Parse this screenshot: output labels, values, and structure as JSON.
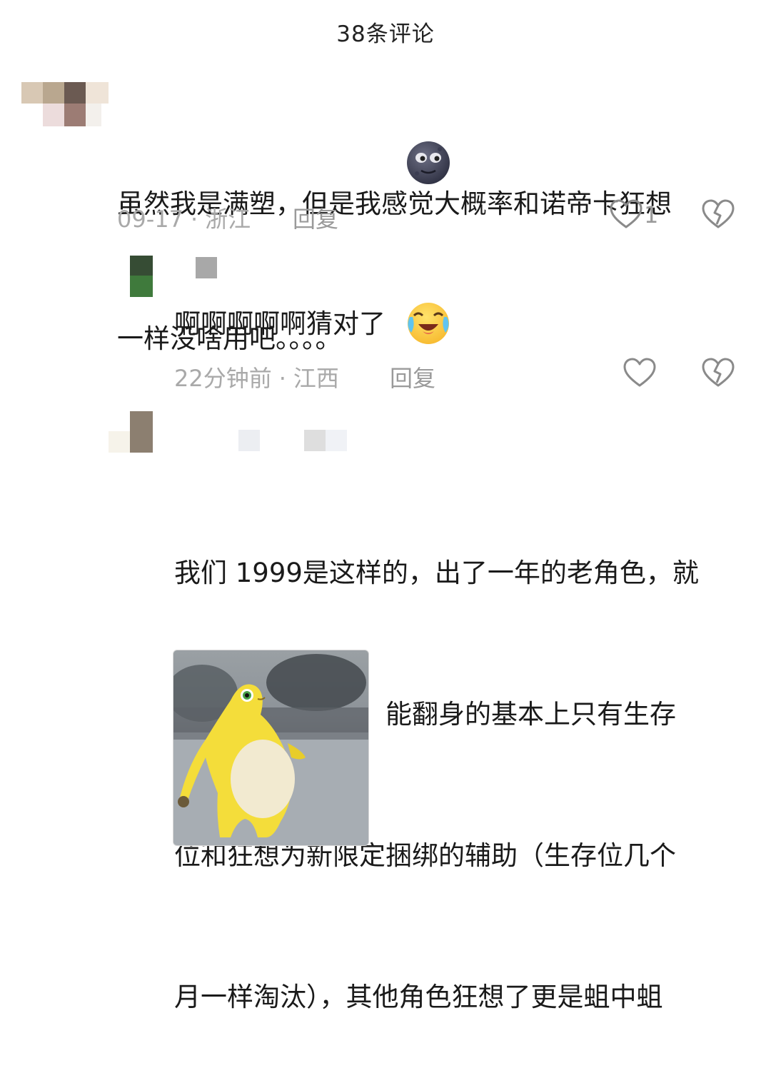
{
  "header": {
    "title": "38条评论"
  },
  "comments": [
    {
      "text_line1": "虽然我是满塑，但是我感觉大概率和诺帝卡狂想",
      "text_line2": "一样没啥用吧。。。。",
      "date": "09-17",
      "location": "浙江",
      "reply_label": "回复",
      "like_count": "1",
      "emoji": "new-moon-face"
    },
    {
      "text": "啊啊啊啊啊猜对了",
      "date": "22分钟前",
      "location": "江西",
      "reply_label": "回复",
      "emoji": "crying-laughing-face"
    },
    {
      "lines": [
        "我们 1999是这样的，出了一年的老角色，就",
        "老老实实吃灰吧，能翻身的基本上只有生存",
        "位和狂想为新限定捆绑的辅助（生存位几个",
        "月一样淘汰），其他角色狂想了更是蛆中蛆"
      ],
      "image": "yellow-creature-meme"
    }
  ],
  "separator": "·",
  "colors": {
    "meta": "#a9a9a9",
    "text": "#1a1a1a",
    "icon": "#8a8a8a"
  }
}
